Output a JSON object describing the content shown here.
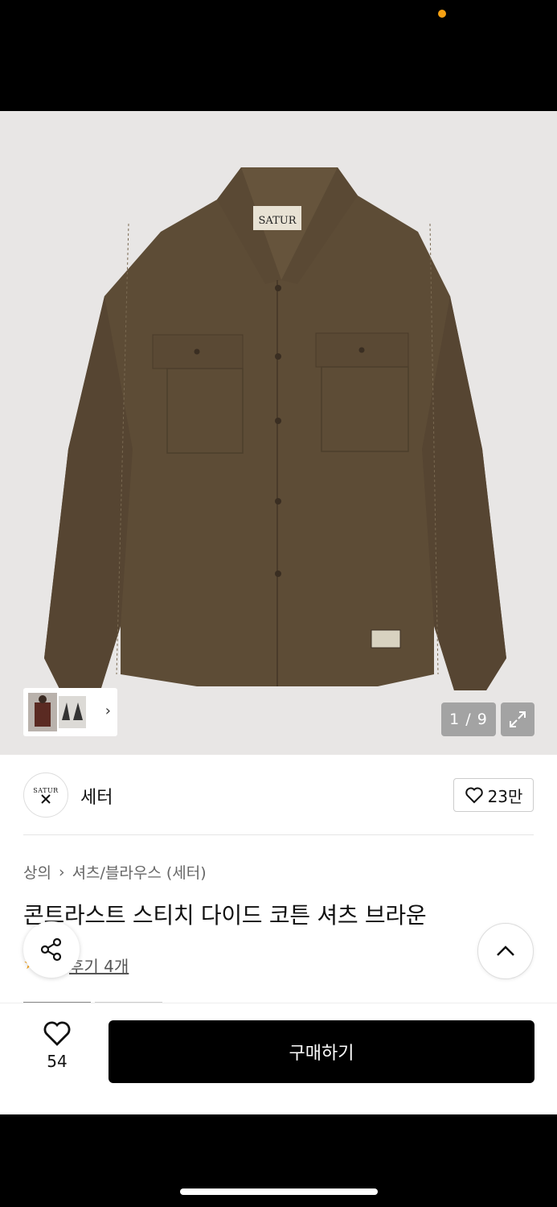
{
  "status": {
    "dot_color": "#f5a012"
  },
  "gallery": {
    "counter": "1 / 9",
    "thumbnail_more_icon": "chevron-right-icon",
    "expand_icon": "expand-arrows-icon"
  },
  "brand": {
    "logo_text": "SATUR",
    "name": "세터",
    "like_count": "23만"
  },
  "breadcrumb": {
    "level1": "상의",
    "separator": "›",
    "level2": "셔츠/블라우스 (세터)"
  },
  "product": {
    "title": "콘트라스트 스티치 다이드 코튼 셔츠 브라운",
    "review_label": "후기 4개",
    "image_label": "SATUR"
  },
  "actions": {
    "wish_count": "54",
    "buy_label": "구매하기"
  },
  "colors": {
    "shirt": "#5d4c36",
    "accent_star": "#f5a012",
    "buy_button": "#000000"
  }
}
